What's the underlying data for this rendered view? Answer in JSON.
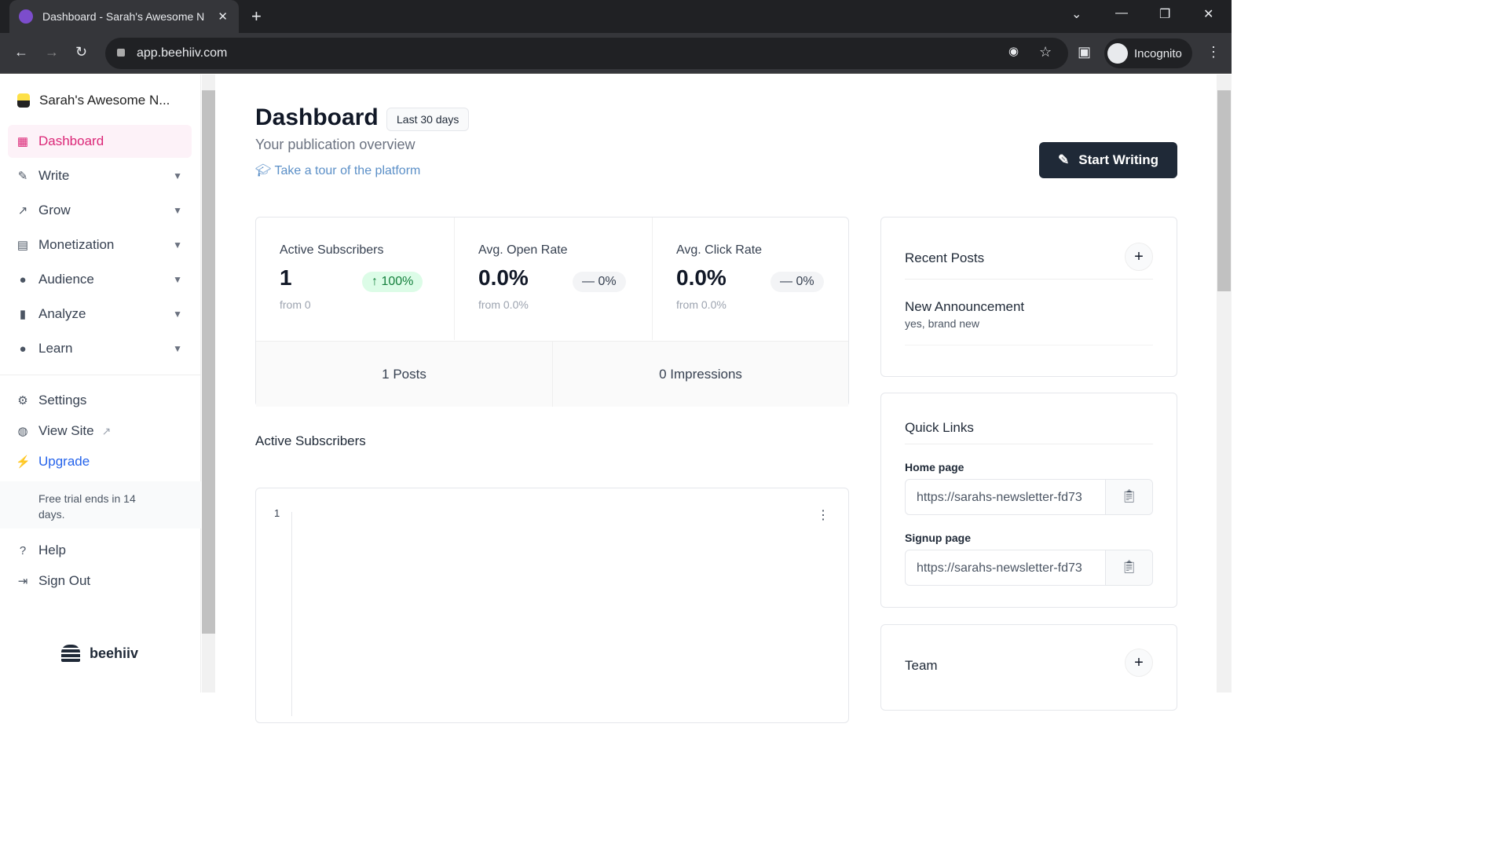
{
  "browser": {
    "tab_title": "Dashboard - Sarah's Awesome N",
    "url": "app.beehiiv.com",
    "profile": "Incognito"
  },
  "sidebar": {
    "publication": "Sarah's Awesome N...",
    "items": [
      {
        "label": "Dashboard",
        "icon": "grid-icon"
      },
      {
        "label": "Write",
        "icon": "pencil-icon"
      },
      {
        "label": "Grow",
        "icon": "trend-icon"
      },
      {
        "label": "Monetization",
        "icon": "money-icon"
      },
      {
        "label": "Audience",
        "icon": "users-icon"
      },
      {
        "label": "Analyze",
        "icon": "bar-chart-icon"
      },
      {
        "label": "Learn",
        "icon": "bulb-icon"
      }
    ],
    "settings": "Settings",
    "view_site": "View Site",
    "upgrade": "Upgrade",
    "trial": "Free trial ends in 14 days.",
    "help": "Help",
    "sign_out": "Sign Out",
    "brand": "beehiiv"
  },
  "header": {
    "title": "Dashboard",
    "range": "Last 30 days",
    "subtitle": "Your publication overview",
    "tour": "Take a tour of the platform",
    "start_writing": "Start Writing"
  },
  "stats": [
    {
      "label": "Active Subscribers",
      "value": "1",
      "change": "100%",
      "from": "from 0"
    },
    {
      "label": "Avg. Open Rate",
      "value": "0.0%",
      "change": "0%",
      "from": "from 0.0%"
    },
    {
      "label": "Avg. Click Rate",
      "value": "0.0%",
      "change": "0%",
      "from": "from 0.0%"
    }
  ],
  "counts": {
    "posts": "1 Posts",
    "impressions": "0 Impressions"
  },
  "chart": {
    "title": "Active Subscribers",
    "y_top": "1"
  },
  "recent": {
    "title": "Recent Posts",
    "post_title": "New Announcement",
    "post_sub": "yes, brand new"
  },
  "quick": {
    "title": "Quick Links",
    "home_label": "Home page",
    "home_url": "https://sarahs-newsletter-fd73",
    "signup_label": "Signup page",
    "signup_url": "https://sarahs-newsletter-fd73"
  },
  "team": {
    "title": "Team"
  },
  "colors": {
    "accent": "#db2777",
    "dark": "#1f2937"
  }
}
